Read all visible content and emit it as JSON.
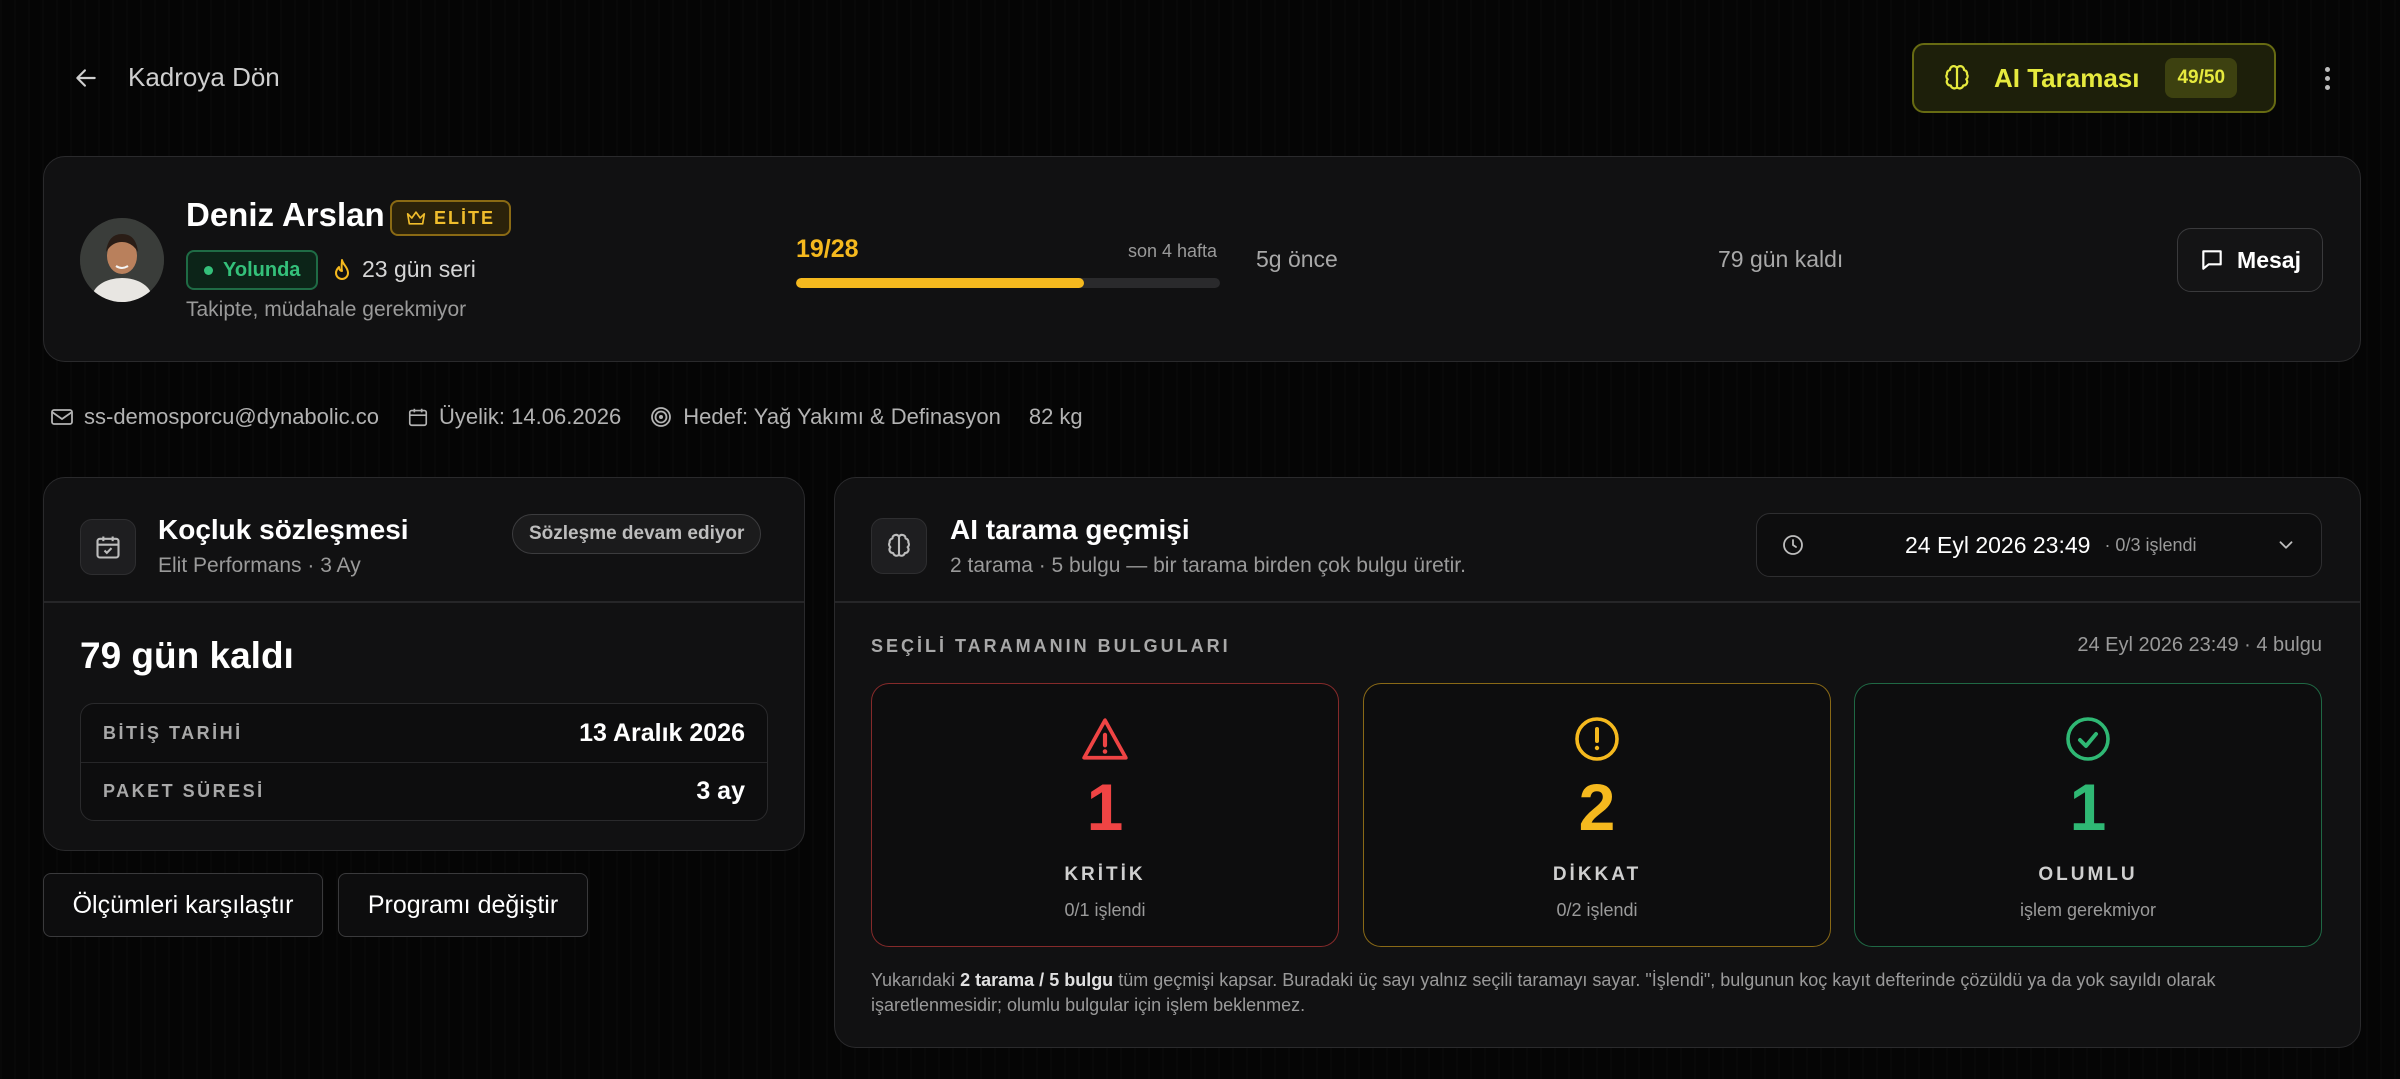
{
  "topbar": {
    "back_label": "Kadroya Dön",
    "ai_scan_label": "AI Taraması",
    "ai_scan_count": "49/50"
  },
  "profile": {
    "name": "Deniz Arslan",
    "tier_badge": "ELİTE",
    "status": "Yolunda",
    "streak": "23 gün seri",
    "subtitle": "Takipte, müdahale gerekmiyor",
    "progress_label": "19/28",
    "progress_fraction": 0.679,
    "progress_period": "son 4 hafta",
    "last_seen": "5g önce",
    "days_left": "79 gün kaldı",
    "message_button": "Mesaj"
  },
  "meta": {
    "email": "ss-demosporcu@dynabolic.co",
    "membership": "Üyelik: 14.06.2026",
    "goal": "Hedef: Yağ Yakımı & Definasyon",
    "weight": "82 kg"
  },
  "contract": {
    "title": "Koçluk sözleşmesi",
    "subtitle": "Elit Performans · 3 Ay",
    "status_badge": "Sözleşme devam ediyor",
    "days_left": "79 gün kaldı",
    "rows": [
      {
        "key": "BİTİŞ TARİHİ",
        "value": "13 Aralık 2026"
      },
      {
        "key": "PAKET SÜRESİ",
        "value": "3 ay"
      }
    ]
  },
  "actions": {
    "compare": "Ölçümleri karşılaştır",
    "change_program": "Programı değiştir"
  },
  "ai_history": {
    "title": "AI tarama geçmişi",
    "subtitle": "2 tarama · 5 bulgu — bir tarama birden çok bulgu üretir.",
    "selected_date": "24 Eyl 2026 23:49",
    "selected_processed": "· 0/3 işlendi",
    "findings_heading": "SEÇİLİ TARAMANIN BULGULARI",
    "findings_meta": "24 Eyl 2026 23:49 · 4 bulgu",
    "stats": [
      {
        "value": "1",
        "label": "KRİTİK",
        "sub": "0/1 işlendi",
        "color": "#ef4444"
      },
      {
        "value": "2",
        "label": "DİKKAT",
        "sub": "0/2 işlendi",
        "color": "#f5b91e"
      },
      {
        "value": "1",
        "label": "OLUMLU",
        "sub": "işlem gerekmiyor",
        "color": "#2fb874"
      }
    ],
    "footnote_pre": "Yukarıdaki",
    "footnote_scans": "2 tarama",
    "footnote_slash": "/",
    "footnote_findings": "5 bulgu",
    "footnote_rest": "tüm geçmişi kapsar. Buradaki üç sayı yalnız seçili taramayı sayar. \"İşlendi\", bulgunun koç kayıt defterinde çözüldü ya da yok sayıldı olarak işaretlenmesidir; olumlu bulgular için işlem beklenmez."
  },
  "colors": {
    "accent_yellow": "#f5b91e",
    "ai_lime": "#e6ea3e",
    "status_green": "#34c07a"
  }
}
